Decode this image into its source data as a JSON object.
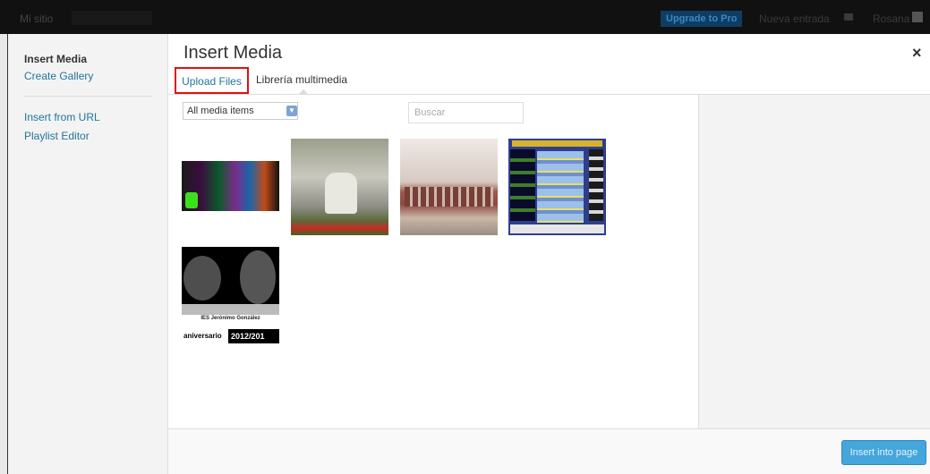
{
  "admin_bar": {
    "site_name": "Mi sitio",
    "upgrade_label": "Upgrade to Pro",
    "new_entry_label": "Nueva entrada",
    "user_name": "Rosana"
  },
  "menu": {
    "items": [
      {
        "label": "Insert Media",
        "active": true
      },
      {
        "label": "Create Gallery",
        "active": false
      },
      {
        "label": "Insert from URL",
        "active": false
      },
      {
        "label": "Playlist Editor",
        "active": false
      }
    ]
  },
  "modal": {
    "title": "Insert Media",
    "close_glyph": "×"
  },
  "tabs": [
    {
      "label": "Upload Files",
      "highlighted": true
    },
    {
      "label": "Librería multimedia",
      "active": true
    }
  ],
  "toolbar": {
    "filter_value": "All media items",
    "search_placeholder": "Buscar"
  },
  "attachments": [
    {
      "kind": "colorful-smoke-image"
    },
    {
      "kind": "statue-image"
    },
    {
      "kind": "building-image"
    },
    {
      "kind": "tecnologia-poster-image"
    },
    {
      "kind": "anniversary-poster-image",
      "caption": "IES Jerónimo González",
      "left_text": "aniversario",
      "right_text": "2012/201"
    }
  ],
  "footer": {
    "insert_label": "Insert into page"
  },
  "colors": {
    "accent": "#21759b",
    "button": "#44a6da",
    "highlight_border": "#e01010"
  }
}
